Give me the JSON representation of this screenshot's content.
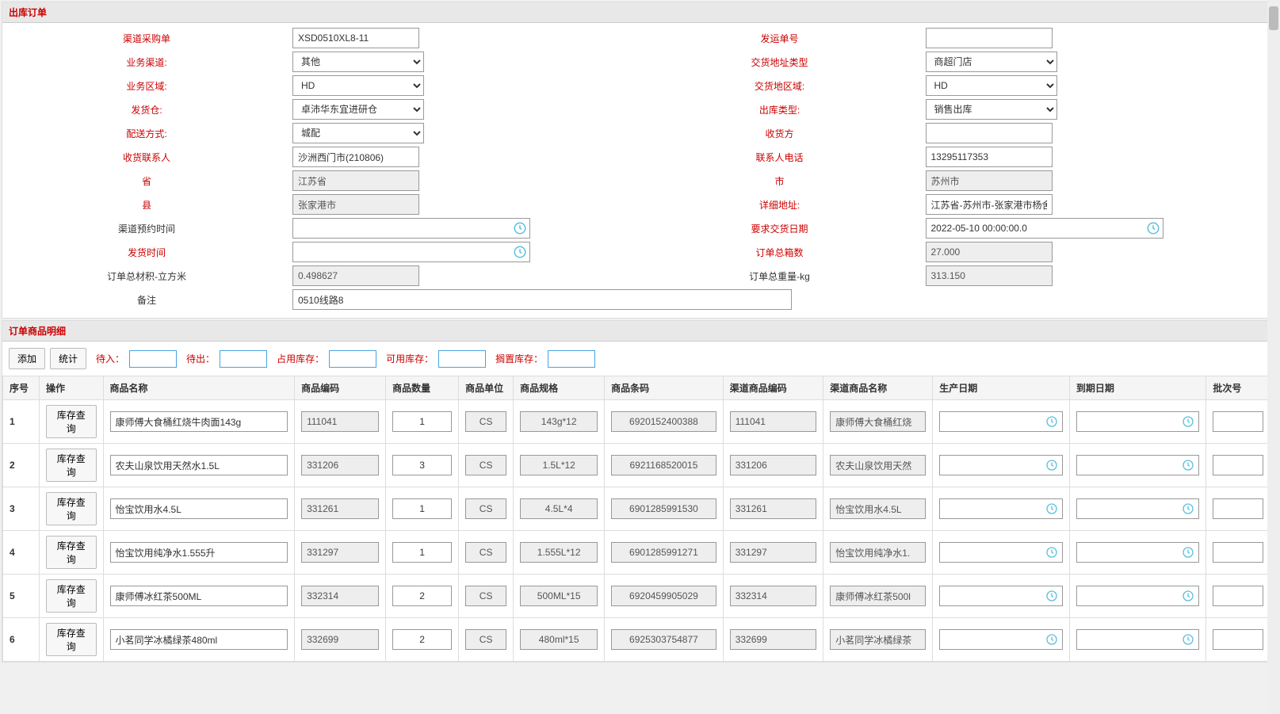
{
  "panel1_title": "出库订单",
  "labels": {
    "channel_po": "渠道采购单",
    "shipment_no": "发运单号",
    "biz_channel": "业务渠道:",
    "delivery_addr_type": "交货地址类型",
    "biz_region": "业务区域:",
    "delivery_region": "交货地区域:",
    "warehouse": "发货仓:",
    "out_type": "出库类型:",
    "delivery_method": "配送方式:",
    "receiver": "收货方",
    "contact": "收货联系人",
    "phone": "联系人电话",
    "province": "省",
    "city": "市",
    "county": "县",
    "address": "详细地址:",
    "appt_time": "渠道预约时间",
    "req_date": "要求交货日期",
    "ship_time": "发货时间",
    "total_box": "订单总箱数",
    "total_vol": "订单总材积-立方米",
    "total_wt": "订单总重量-kg",
    "remark": "备注"
  },
  "values": {
    "channel_po": "XSD0510XL8-11",
    "shipment_no": "",
    "biz_channel": "其他",
    "delivery_addr_type": "商超门店",
    "biz_region": "HD",
    "delivery_region": "HD",
    "warehouse": "卓沛华东宜进研仓",
    "out_type": "销售出库",
    "delivery_method": "城配",
    "receiver": "",
    "contact": "沙洲西门市(210806)",
    "phone": "13295117353",
    "province": "江苏省",
    "city": "苏州市",
    "county": "张家港市",
    "address": "江苏省-苏州市-张家港市杨舍镇沙洲西路",
    "appt_time": "",
    "req_date": "2022-05-10 00:00:00.0",
    "ship_time": "",
    "total_box": "27.000",
    "total_vol": "0.498627",
    "total_wt": "313.150",
    "remark": "0510线路8"
  },
  "panel2_title": "订单商品明细",
  "buttons": {
    "add": "添加",
    "stat": "统计",
    "stock_query": "库存查询"
  },
  "stats": {
    "in_label": "待入：",
    "out_label": "待出：",
    "occupy_label": "占用库存：",
    "avail_label": "可用库存：",
    "idle_label": "搁置库存："
  },
  "columns": {
    "seq": "序号",
    "op": "操作",
    "name": "商品名称",
    "code": "商品编码",
    "qty": "商品数量",
    "unit": "商品单位",
    "spec": "商品规格",
    "barcode": "商品条码",
    "ch_code": "渠道商品编码",
    "ch_name": "渠道商品名称",
    "prod_date": "生产日期",
    "exp_date": "到期日期",
    "batch": "批次号"
  },
  "rows": [
    {
      "seq": "1",
      "name": "康师傅大食桶红烧牛肉面143g",
      "code": "111041",
      "qty": "1",
      "unit": "CS",
      "spec": "143g*12",
      "barcode": "6920152400388",
      "ch_code": "111041",
      "ch_name": "康师傅大食桶红烧"
    },
    {
      "seq": "2",
      "name": "农夫山泉饮用天然水1.5L",
      "code": "331206",
      "qty": "3",
      "unit": "CS",
      "spec": "1.5L*12",
      "barcode": "6921168520015",
      "ch_code": "331206",
      "ch_name": "农夫山泉饮用天然"
    },
    {
      "seq": "3",
      "name": "怡宝饮用水4.5L",
      "code": "331261",
      "qty": "1",
      "unit": "CS",
      "spec": "4.5L*4",
      "barcode": "6901285991530",
      "ch_code": "331261",
      "ch_name": "怡宝饮用水4.5L"
    },
    {
      "seq": "4",
      "name": "怡宝饮用纯净水1.555升",
      "code": "331297",
      "qty": "1",
      "unit": "CS",
      "spec": "1.555L*12",
      "barcode": "6901285991271",
      "ch_code": "331297",
      "ch_name": "怡宝饮用纯净水1."
    },
    {
      "seq": "5",
      "name": "康师傅冰红茶500ML",
      "code": "332314",
      "qty": "2",
      "unit": "CS",
      "spec": "500ML*15",
      "barcode": "6920459905029",
      "ch_code": "332314",
      "ch_name": "康师傅冰红茶500l"
    },
    {
      "seq": "6",
      "name": "小茗同学冰橘绿茶480ml",
      "code": "332699",
      "qty": "2",
      "unit": "CS",
      "spec": "480ml*15",
      "barcode": "6925303754877",
      "ch_code": "332699",
      "ch_name": "小茗同学冰橘绿茶"
    }
  ]
}
